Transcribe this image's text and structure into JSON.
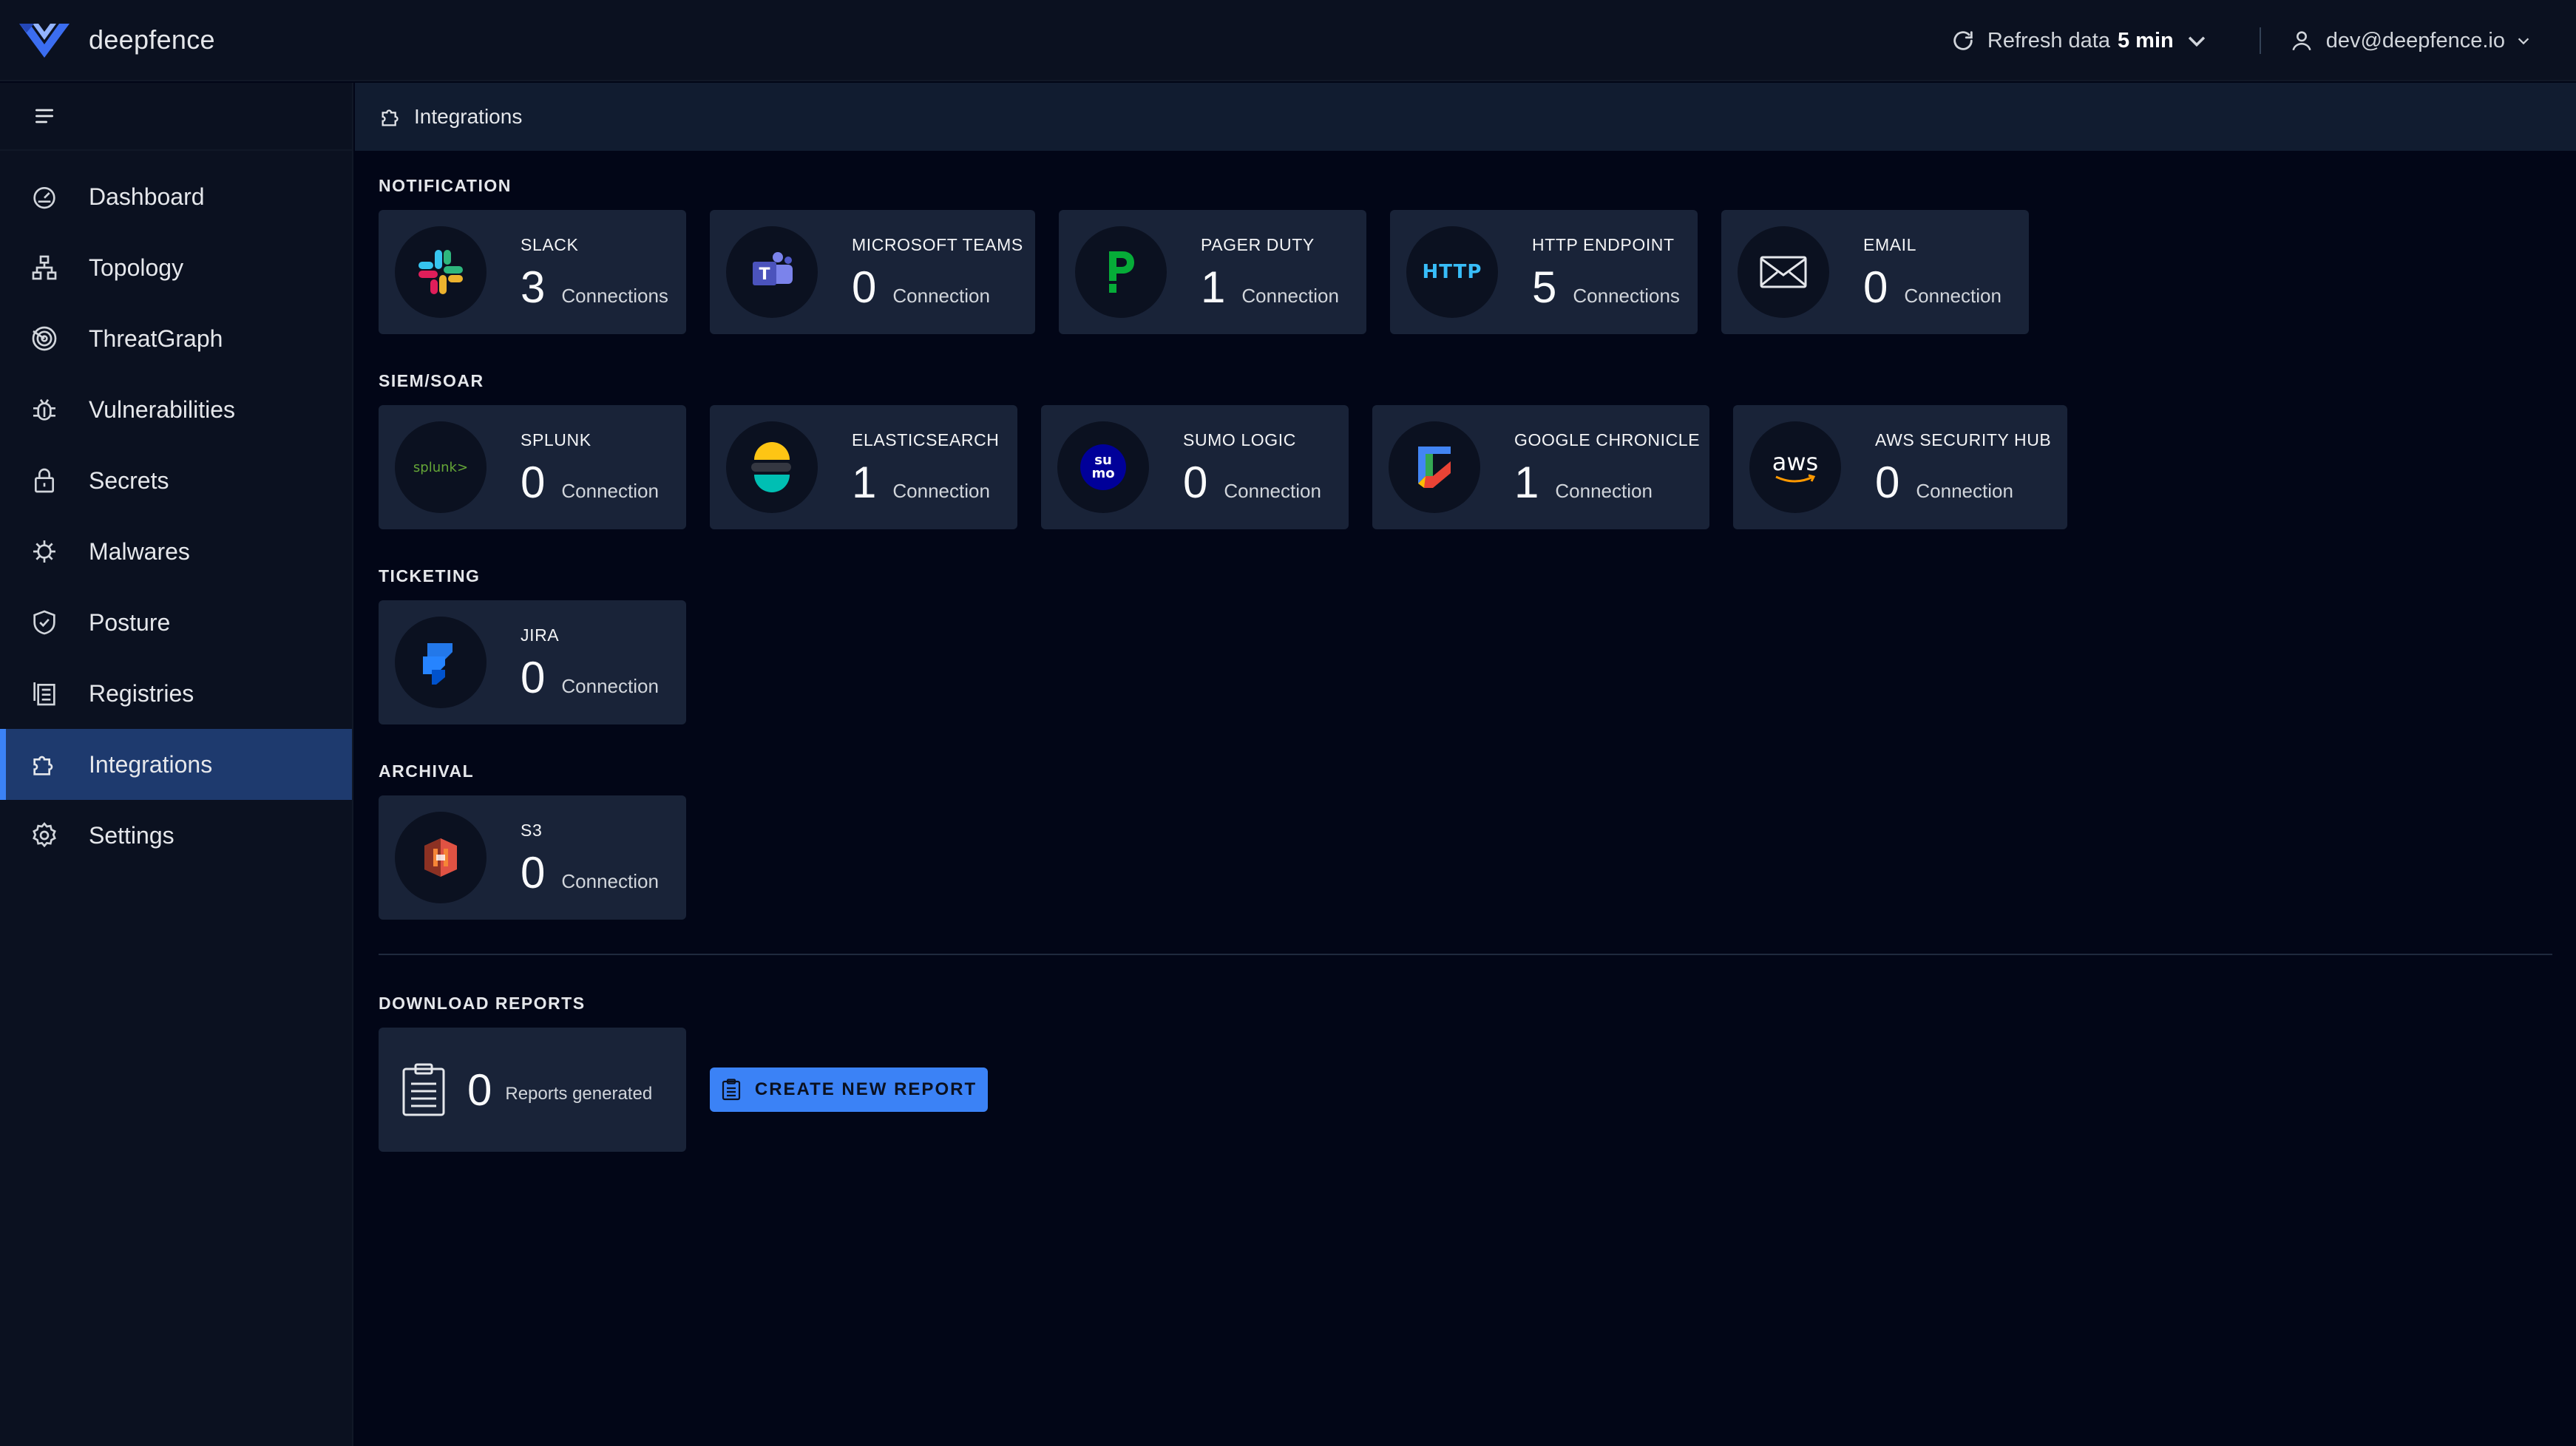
{
  "brand": {
    "name": "deepfence"
  },
  "topbar": {
    "refresh_label": "Refresh data",
    "refresh_value": "5 min",
    "user_email": "dev@deepfence.io"
  },
  "breadcrumb": {
    "current": "Integrations"
  },
  "sidebar": {
    "items": [
      {
        "label": "Dashboard",
        "icon": "dashboard-icon"
      },
      {
        "label": "Topology",
        "icon": "topology-icon"
      },
      {
        "label": "ThreatGraph",
        "icon": "threatgraph-icon"
      },
      {
        "label": "Vulnerabilities",
        "icon": "bug-icon"
      },
      {
        "label": "Secrets",
        "icon": "lock-icon"
      },
      {
        "label": "Malwares",
        "icon": "malware-icon"
      },
      {
        "label": "Posture",
        "icon": "shield-icon"
      },
      {
        "label": "Registries",
        "icon": "registry-icon"
      },
      {
        "label": "Integrations",
        "icon": "puzzle-icon",
        "active": true
      },
      {
        "label": "Settings",
        "icon": "gear-icon"
      }
    ]
  },
  "sections": {
    "notification": {
      "title": "NOTIFICATION",
      "cards": [
        {
          "name": "SLACK",
          "count": "3",
          "unit": "Connections"
        },
        {
          "name": "MICROSOFT TEAMS",
          "count": "0",
          "unit": "Connection"
        },
        {
          "name": "PAGER DUTY",
          "count": "1",
          "unit": "Connection"
        },
        {
          "name": "HTTP ENDPOINT",
          "count": "5",
          "unit": "Connections",
          "logo_text": "HTTP"
        },
        {
          "name": "EMAIL",
          "count": "0",
          "unit": "Connection"
        }
      ]
    },
    "siem": {
      "title": "SIEM/SOAR",
      "cards": [
        {
          "name": "SPLUNK",
          "count": "0",
          "unit": "Connection",
          "logo_text": "splunk>"
        },
        {
          "name": "ELASTICSEARCH",
          "count": "1",
          "unit": "Connection"
        },
        {
          "name": "SUMO LOGIC",
          "count": "0",
          "unit": "Connection",
          "logo_text_top": "su",
          "logo_text_bottom": "mo"
        },
        {
          "name": "GOOGLE CHRONICLE",
          "count": "1",
          "unit": "Connection"
        },
        {
          "name": "AWS SECURITY HUB",
          "count": "0",
          "unit": "Connection",
          "logo_text": "aws"
        }
      ]
    },
    "ticketing": {
      "title": "TICKETING",
      "cards": [
        {
          "name": "JIRA",
          "count": "0",
          "unit": "Connection"
        }
      ]
    },
    "archival": {
      "title": "ARCHIVAL",
      "cards": [
        {
          "name": "S3",
          "count": "0",
          "unit": "Connection"
        }
      ]
    }
  },
  "reports": {
    "title": "DOWNLOAD REPORTS",
    "count": "0",
    "unit": "Reports generated",
    "create_button": "CREATE NEW REPORT"
  },
  "colors": {
    "background": "#020617",
    "panel": "#0b1120",
    "card": "#192338",
    "accent": "#3b82f6",
    "active_nav": "#1e3a6e"
  }
}
